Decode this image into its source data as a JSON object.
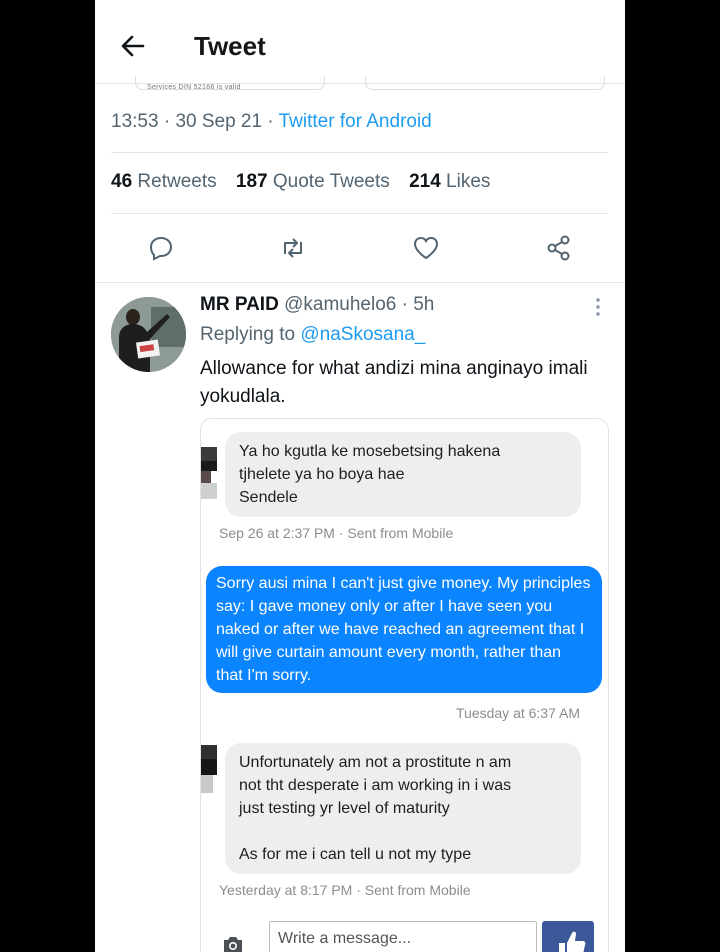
{
  "header": {
    "title": "Tweet"
  },
  "peek": {
    "text": "Services DIN 52186 is valid"
  },
  "tweet_meta": {
    "time": "13:53",
    "date": "30 Sep 21",
    "source": "Twitter for Android"
  },
  "stats": {
    "retweets_count": "46",
    "retweets_label": "Retweets",
    "quotes_count": "187",
    "quotes_label": "Quote Tweets",
    "likes_count": "214",
    "likes_label": "Likes"
  },
  "reply": {
    "name": "MR PAID",
    "handle": "@kamuhelo6",
    "age": "5h",
    "replying_prefix": "Replying to ",
    "replying_handle": "@naSkosana_",
    "text": "Allowance for what andizi mina anginayo imali yokudlala."
  },
  "chat": {
    "msg1": "Ya ho kgutla ke mosebetsing hakena\ntjhelete ya ho boya hae\nSendele",
    "ts1": "Sep 26 at 2:37 PM · Sent from Mobile",
    "msg2": "Sorry ausi mina I can't just give money. My principles  say: I gave money only or after I have seen you naked or after we have reached an agreement that I will give curtain amount every month, rather than that I'm sorry.",
    "ts2": "Tuesday at 6:37 AM",
    "msg3": "Unfortunately  am not a prostitute n am\nnot tht desperate  i am working in i was\njust testing  yr level of maturity\n\nAs for me i can tell u not my type",
    "ts3": "Yesterday at 8:17 PM · Sent from Mobile",
    "input_placeholder": "Write a message..."
  },
  "colors": {
    "link_blue": "#1d9bf0",
    "messenger_blue": "#0a84ff",
    "muted": "#536471"
  }
}
